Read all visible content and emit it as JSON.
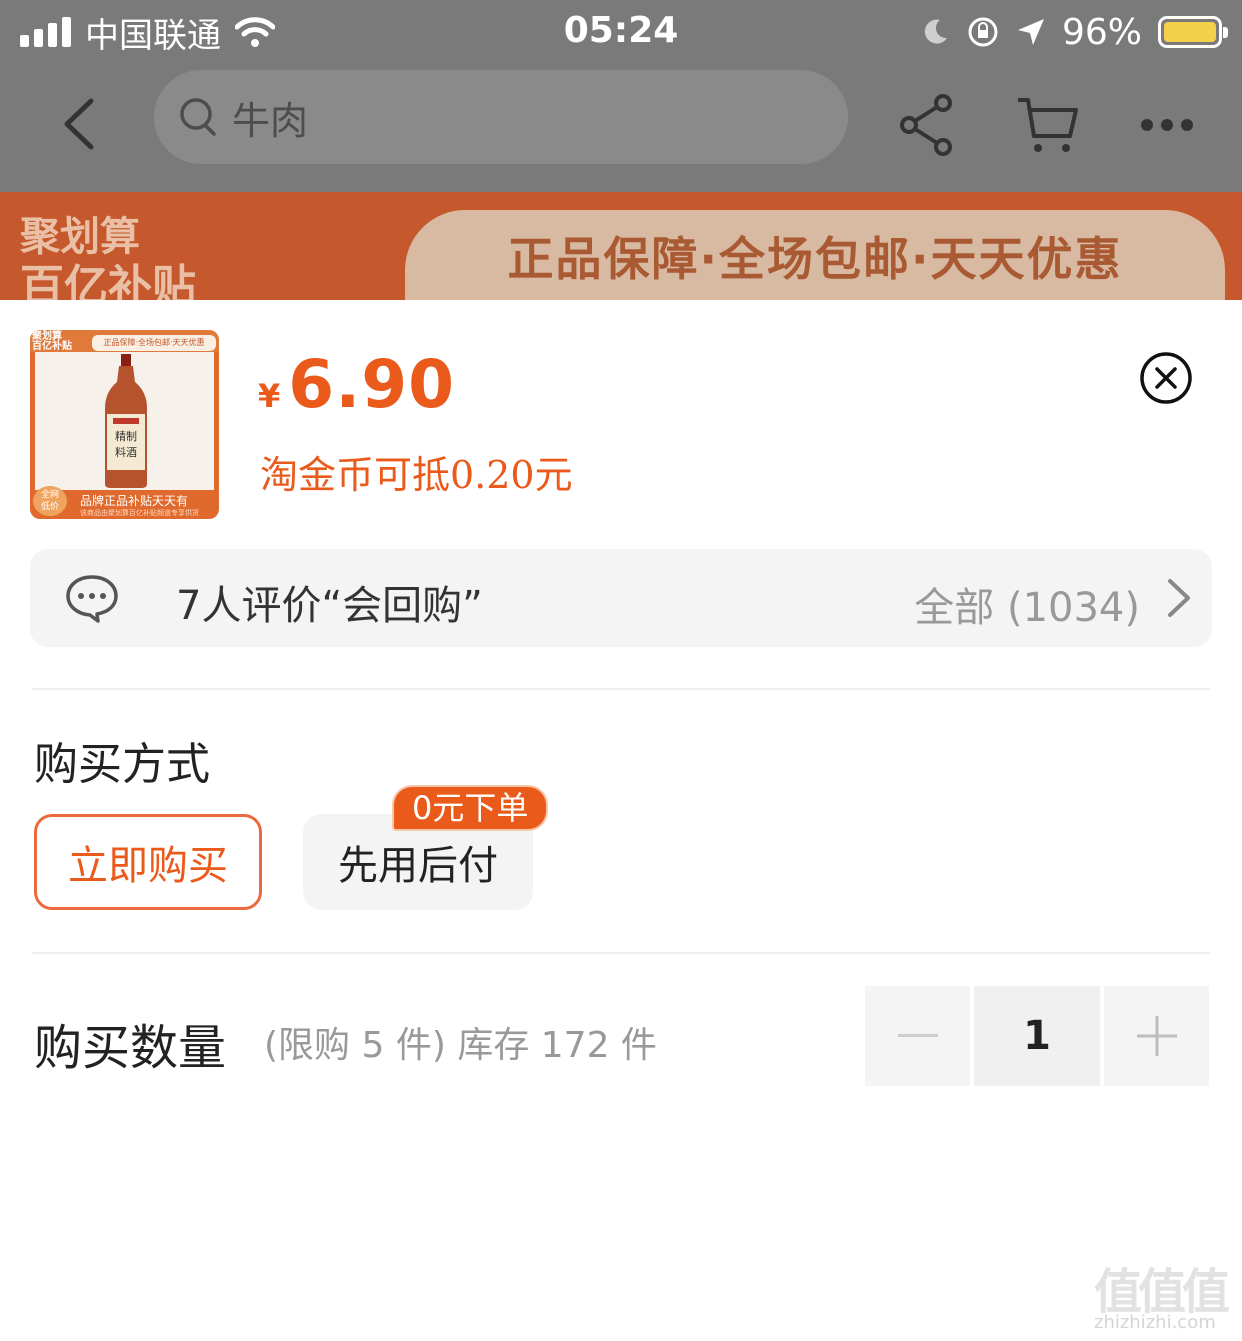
{
  "status_bar": {
    "carrier": "中国联通",
    "time": "05:24",
    "battery": "96%",
    "battery_level": 0.96
  },
  "nav": {
    "search_placeholder": "牛肉",
    "icons": [
      "back-icon",
      "search-icon",
      "share-icon",
      "cart-icon",
      "more-icon"
    ]
  },
  "banner": {
    "brand_line1": "聚划算",
    "brand_line2": "百亿补贴",
    "slogan": "正品保障·全场包邮·天天优惠"
  },
  "product": {
    "thumb_top": "正品保障·全场包邮·天天优惠",
    "thumb_logo": "聚划算\n百亿补贴",
    "thumb_badge": "全网\n低价",
    "thumb_bottom": "品牌正品补贴天天有",
    "thumb_sub": "该商品由聚划算百亿补贴频道专享供货",
    "currency": "¥",
    "price": "6.90",
    "coin_note": "淘金币可抵0.20元"
  },
  "reviews": {
    "summary": "7人评价“会回购”",
    "all_label": "全部 (1034)"
  },
  "purchase_method": {
    "title": "购买方式",
    "options": [
      "立即购买",
      "先用后付"
    ],
    "selected": "立即购买",
    "tag": "0元下单"
  },
  "quantity": {
    "title": "购买数量",
    "note": "(限购 5 件) 库存 172 件",
    "value": "1",
    "minus_label": "−",
    "plus_label": "+"
  },
  "watermark": {
    "glyphs": "值值值",
    "url": "zhizhizhi.com"
  },
  "colors": {
    "accent": "#ea5a1a",
    "overlay": "#7a7a7a",
    "banner": "#c5582c"
  }
}
